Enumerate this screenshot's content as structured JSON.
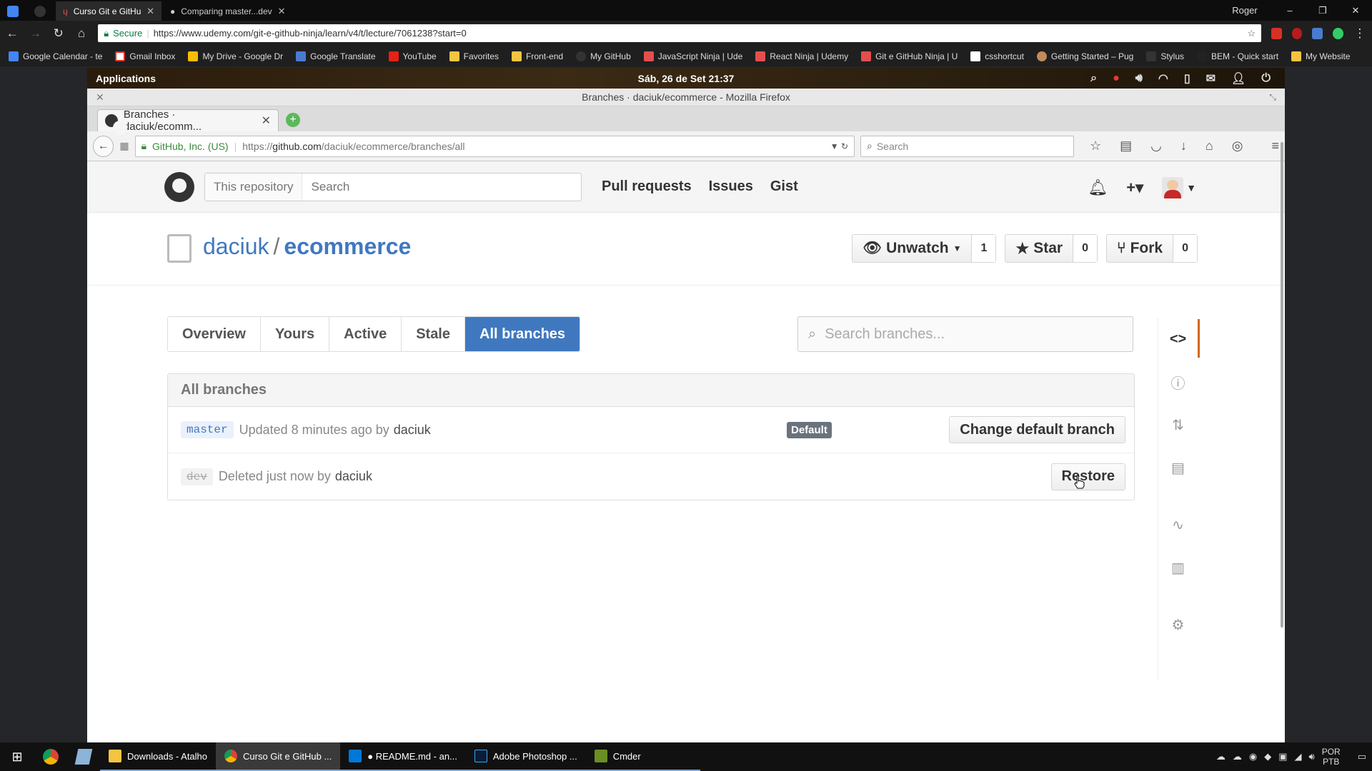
{
  "chrome": {
    "tabs": [
      {
        "title": "Curso Git e GitHub Ninja",
        "active": true
      },
      {
        "title": "Comparing master...dev",
        "active": false
      }
    ],
    "user": "Roger",
    "secure_label": "Secure",
    "url": "https://www.udemy.com/git-e-github-ninja/learn/v4/t/lecture/7061238?start=0",
    "bookmarks": [
      "Google Calendar - te",
      "Gmail Inbox",
      "My Drive - Google Dr",
      "Google Translate",
      "YouTube",
      "Favorites",
      "Front-end",
      "My GitHub",
      "JavaScript Ninja | Ude",
      "React Ninja | Udemy",
      "Git e GitHub Ninja | U",
      "csshortcut",
      "Getting Started – Pug",
      "Stylus",
      "BEM - Quick start",
      "My Website"
    ]
  },
  "vm": {
    "applications_label": "Applications",
    "clock": "Sáb, 26 de Set 21:37",
    "window_title": "Branches · daciuk/ecommerce - Mozilla Firefox",
    "tab_title": "Branches · daciuk/ecomm...",
    "identity": "GitHub, Inc. (US)",
    "url_prefix": "https://",
    "url_host": "github.com",
    "url_path": "/daciuk/ecommerce/branches/all",
    "search_placeholder": "Search"
  },
  "github": {
    "scope_label": "This repository",
    "search_placeholder": "Search",
    "nav": [
      "Pull requests",
      "Issues",
      "Gist"
    ],
    "owner": "daciuk",
    "separator": "/",
    "repo": "ecommerce",
    "unwatch_label": "Unwatch",
    "watch_count": "1",
    "star_label": "Star",
    "star_count": "0",
    "fork_label": "Fork",
    "fork_count": "0",
    "subnav": [
      "Overview",
      "Yours",
      "Active",
      "Stale",
      "All branches"
    ],
    "branch_search_placeholder": "Search branches...",
    "box_title": "All branches",
    "branches": [
      {
        "name": "master",
        "status": "Updated 8 minutes ago by",
        "user": "daciuk",
        "badge": "Default",
        "action": "Change default branch"
      },
      {
        "name": "dev",
        "status": "Deleted just now by",
        "user": "daciuk",
        "action": "Restore"
      }
    ]
  },
  "taskbar": {
    "apps": [
      "Downloads - Atalho",
      "Curso Git e GitHub ...",
      "● README.md - an...",
      "Adobe Photoshop ...",
      "Cmder"
    ],
    "lang_top": "POR",
    "lang_bottom": "PTB"
  }
}
